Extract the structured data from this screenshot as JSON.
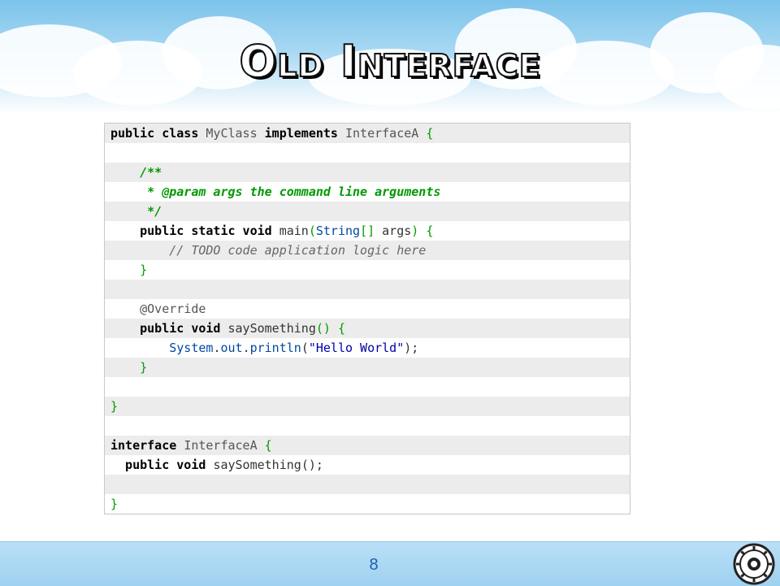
{
  "slide": {
    "title": "Old Interface",
    "page_number": "8"
  },
  "code": [
    [
      {
        "t": "public class ",
        "c": "kw"
      },
      {
        "t": "MyClass ",
        "c": "ty"
      },
      {
        "t": "implements ",
        "c": "kw"
      },
      {
        "t": "InterfaceA ",
        "c": "ty"
      },
      {
        "t": "{",
        "c": "br"
      }
    ],
    [],
    [
      {
        "t": "    /**",
        "c": "cm"
      }
    ],
    [
      {
        "t": "     * @param args the command line arguments",
        "c": "cm"
      }
    ],
    [
      {
        "t": "     */",
        "c": "cm"
      }
    ],
    [
      {
        "t": "    public static void ",
        "c": "kw"
      },
      {
        "t": "main",
        "c": "fn"
      },
      {
        "t": "(",
        "c": "br"
      },
      {
        "t": "String",
        "c": "cl"
      },
      {
        "t": "[] ",
        "c": "br"
      },
      {
        "t": "args",
        "c": "fn"
      },
      {
        "t": ") {",
        "c": "br"
      }
    ],
    [
      {
        "t": "        // TODO code application logic here",
        "c": "gc"
      }
    ],
    [
      {
        "t": "    }",
        "c": "br"
      }
    ],
    [],
    [
      {
        "t": "    @Override",
        "c": "an"
      }
    ],
    [
      {
        "t": "    public void ",
        "c": "kw"
      },
      {
        "t": "saySomething",
        "c": "fn"
      },
      {
        "t": "() {",
        "c": "br"
      }
    ],
    [
      {
        "t": "        System",
        "c": "cl"
      },
      {
        "t": ".",
        "c": "fn"
      },
      {
        "t": "out",
        "c": "cl"
      },
      {
        "t": ".",
        "c": "fn"
      },
      {
        "t": "println",
        "c": "cl"
      },
      {
        "t": "(",
        "c": "fn"
      },
      {
        "t": "\"Hello World\"",
        "c": "st"
      },
      {
        "t": ");",
        "c": "fn"
      }
    ],
    [
      {
        "t": "    }",
        "c": "br"
      }
    ],
    [],
    [
      {
        "t": "}",
        "c": "br"
      }
    ],
    [],
    [
      {
        "t": "interface ",
        "c": "kw"
      },
      {
        "t": "InterfaceA ",
        "c": "ty"
      },
      {
        "t": "{",
        "c": "br"
      }
    ],
    [
      {
        "t": "  public void ",
        "c": "kw"
      },
      {
        "t": "saySomething",
        "c": "fn"
      },
      {
        "t": "();",
        "c": "fn"
      }
    ],
    [],
    [
      {
        "t": "}",
        "c": "br"
      }
    ]
  ],
  "colors": {
    "keyword": "#000000",
    "bracket_green": "#009900",
    "comment_green": "#009900",
    "string_blue": "#0000aa",
    "page_number": "#1f5fb4"
  },
  "icons": {
    "seal": "university-seal-icon"
  }
}
